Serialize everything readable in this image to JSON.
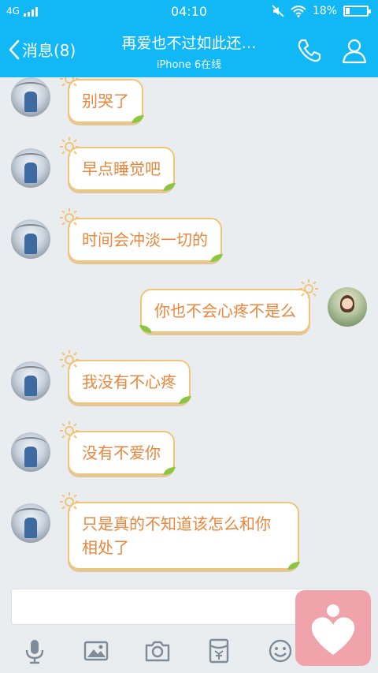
{
  "status_bar": {
    "network": "4G",
    "time": "04:10",
    "battery_percent": "18%",
    "battery_level": 0.18
  },
  "nav": {
    "back_label": "消息(8)",
    "title": "再爱也不过如此还…",
    "subtitle": "iPhone 6在线",
    "icons": [
      "phone-icon",
      "profile-icon"
    ]
  },
  "messages": [
    {
      "side": "left",
      "text": "别哭了"
    },
    {
      "side": "left",
      "text": "早点睡觉吧"
    },
    {
      "side": "left",
      "text": "时间会冲淡一切的"
    },
    {
      "side": "right",
      "text": "你也不会心疼不是么"
    },
    {
      "side": "left",
      "text": "我没有不心疼"
    },
    {
      "side": "left",
      "text": "没有不爱你"
    },
    {
      "side": "left",
      "text": "只是真的不知道该怎么和你相处了"
    }
  ],
  "input": {
    "value": "",
    "toolbar_icons": [
      "microphone-icon",
      "image-icon",
      "camera-icon",
      "red-packet-icon",
      "emoji-icon"
    ]
  },
  "colors": {
    "header": "#12b7f5",
    "bubble_text": "#e8873d",
    "bubble_border": "#f0c57a",
    "sticker": "#f0a3ab"
  }
}
